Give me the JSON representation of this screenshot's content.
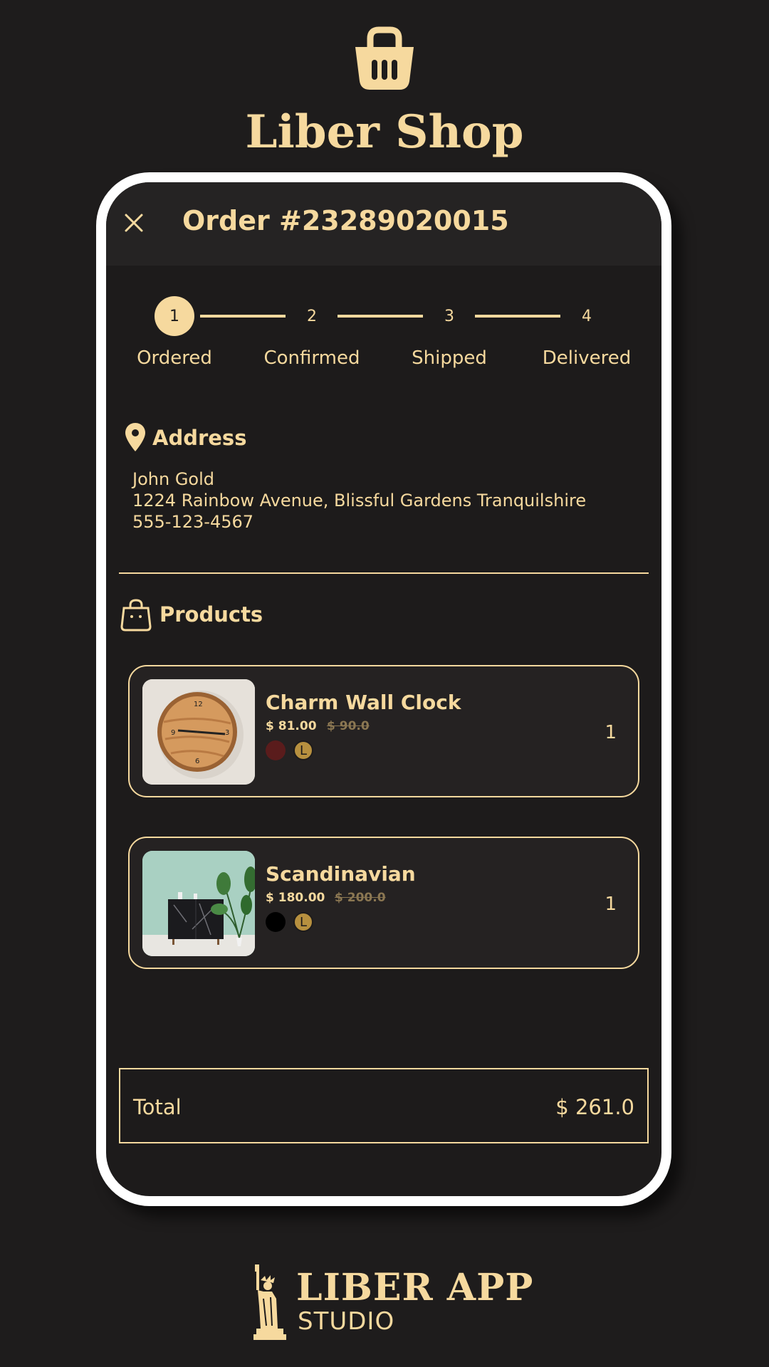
{
  "brand": {
    "title": "Liber Shop",
    "icon": "basket-icon"
  },
  "order": {
    "title": "Order #23289020015"
  },
  "stepper": {
    "current": 1,
    "steps": [
      {
        "number": "1",
        "label": "Ordered"
      },
      {
        "number": "2",
        "label": "Confirmed"
      },
      {
        "number": "3",
        "label": "Shipped"
      },
      {
        "number": "4",
        "label": "Delivered"
      }
    ]
  },
  "address": {
    "heading": "Address",
    "name": "John Gold",
    "street": "1224 Rainbow Avenue, Blissful Gardens Tranquilshire",
    "phone": "555-123-4567"
  },
  "products": {
    "heading": "Products",
    "items": [
      {
        "name": "Charm Wall Clock",
        "price": "$ 81.00",
        "old_price": "$ 90.0",
        "color": "#5a1c1c",
        "size": "L",
        "qty": "1"
      },
      {
        "name": "Scandinavian",
        "price": "$ 180.00",
        "old_price": "$ 200.0",
        "color": "#000000",
        "size": "L",
        "qty": "1"
      }
    ]
  },
  "total": {
    "label": "Total",
    "value": "$ 261.0"
  },
  "footer": {
    "title": "LIBER APP",
    "subtitle": "STUDIO"
  },
  "colors": {
    "background": "#1e1c1c",
    "accent": "#f6d99e",
    "card": "#252222"
  }
}
